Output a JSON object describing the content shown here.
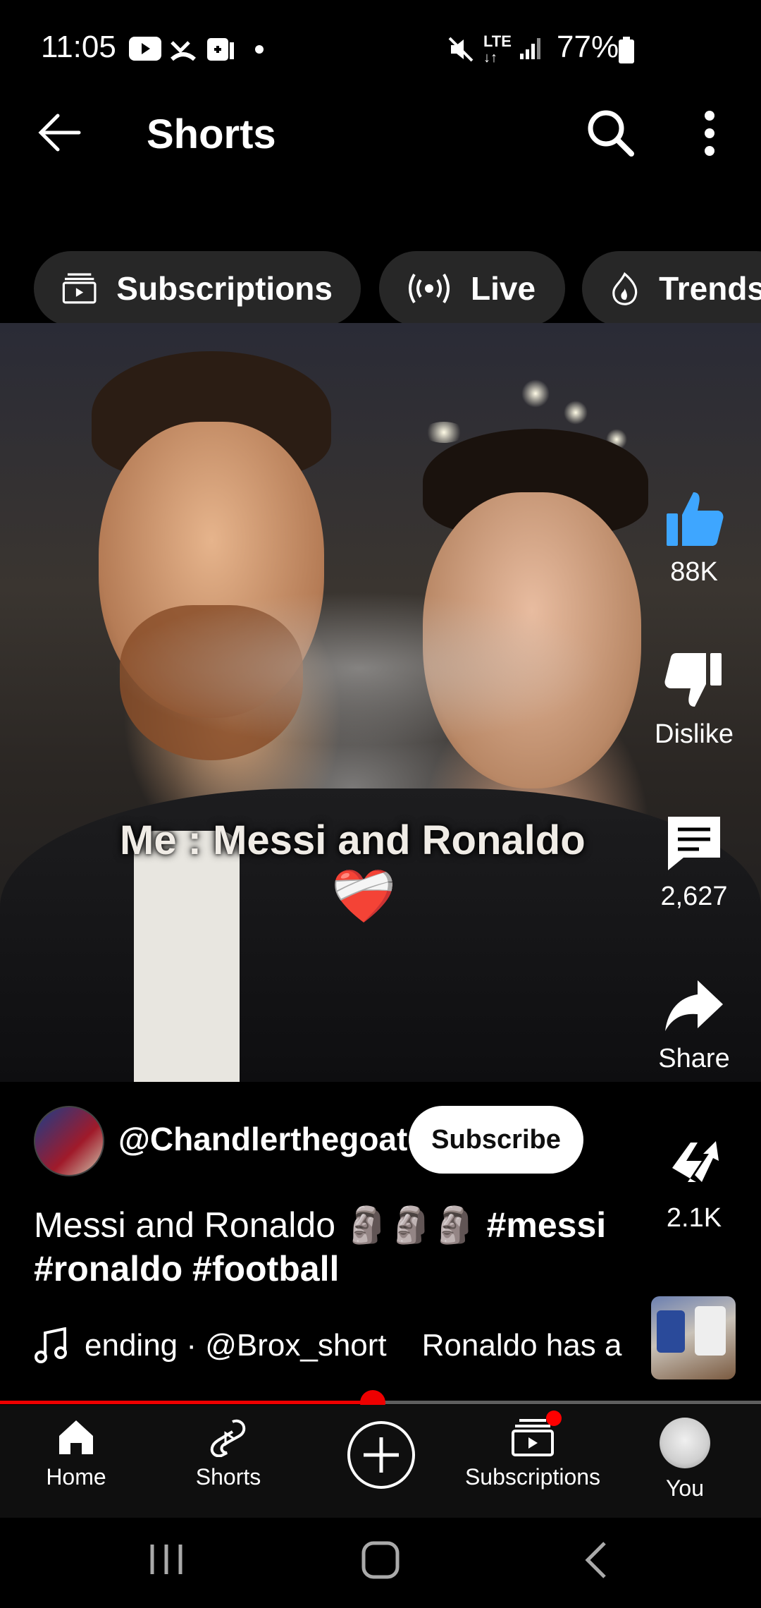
{
  "status_bar": {
    "time": "11:05",
    "battery": "77%",
    "network": "LTE"
  },
  "header": {
    "title": "Shorts",
    "back_icon": "arrow-left-icon",
    "search_icon": "search-icon",
    "more_icon": "more-vertical-icon"
  },
  "chips": [
    {
      "label": "Subscriptions",
      "icon": "subscriptions-icon"
    },
    {
      "label": "Live",
      "icon": "live-icon"
    },
    {
      "label": "Trends",
      "icon": "trending-icon"
    }
  ],
  "video": {
    "caption": "Me : Messi and Ronaldo",
    "caption_emoji": "❤️‍🩹"
  },
  "actions": {
    "like_count": "88K",
    "dislike_label": "Dislike",
    "comment_count": "2,627",
    "share_label": "Share",
    "remix_count": "2.1K"
  },
  "channel": {
    "handle": "@Chandlerthegoat",
    "subscribe_label": "Subscribe"
  },
  "description": {
    "text": "Messi and Ronaldo 🗿🗿🗿",
    "tag1": "#messi",
    "tag2": "#ronaldo",
    "tag3": "#football"
  },
  "music": {
    "ticker1": "ending · @Brox_short",
    "ticker2": "Ronaldo has a"
  },
  "progress": {
    "played_fraction": 0.49
  },
  "nav": [
    {
      "label": "Home",
      "icon": "home-icon"
    },
    {
      "label": "Shorts",
      "icon": "shorts-icon"
    },
    {
      "label": "",
      "icon": "create-icon"
    },
    {
      "label": "Subscriptions",
      "icon": "subscriptions-icon"
    },
    {
      "label": "You",
      "icon": "avatar"
    }
  ],
  "colors": {
    "accent": "#ff0000",
    "like_blue": "#3ea6ff",
    "chip_bg": "#272727"
  }
}
